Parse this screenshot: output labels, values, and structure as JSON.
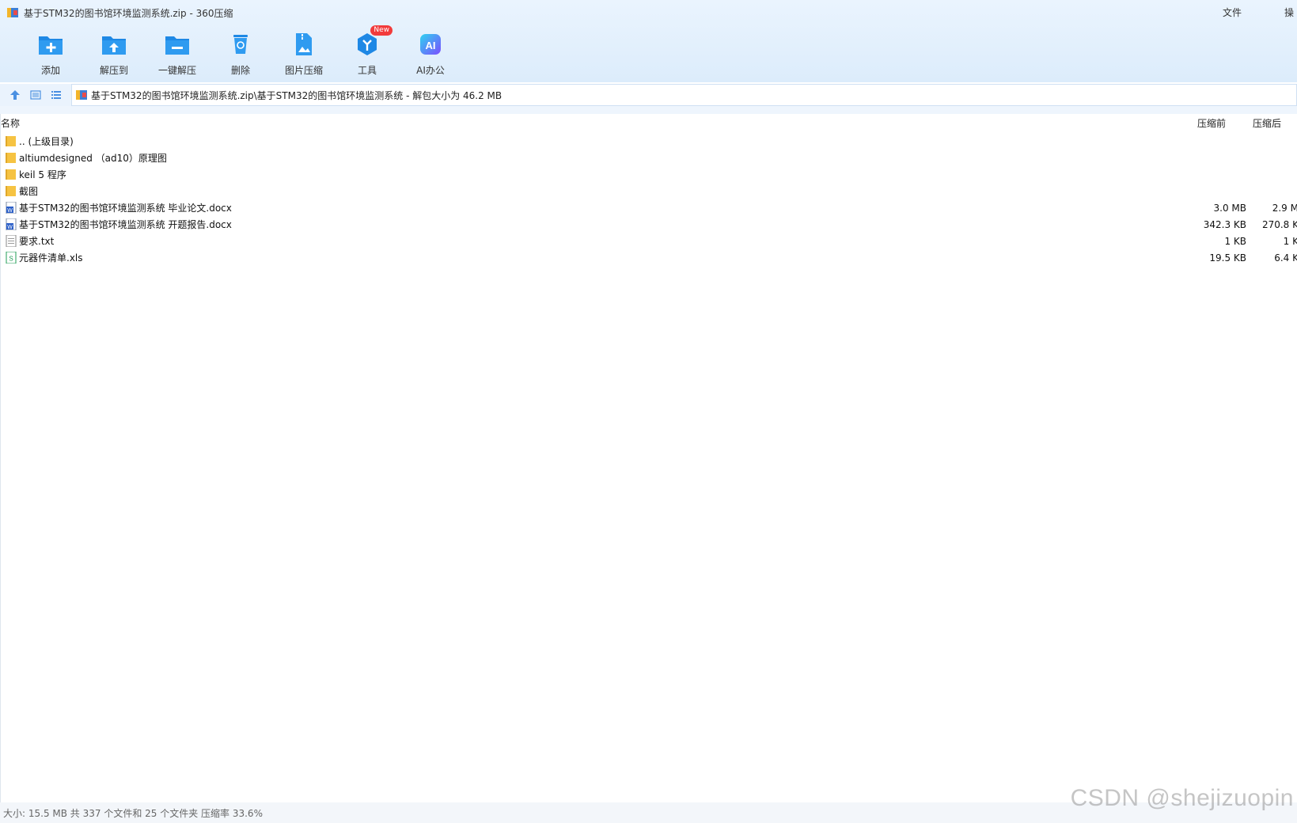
{
  "window": {
    "title": "基于STM32的图书馆环境监测系统.zip - 360压缩",
    "menu": [
      "文件",
      "操"
    ]
  },
  "toolbar": [
    {
      "label": "添加",
      "icon": "add-icon"
    },
    {
      "label": "解压到",
      "icon": "extract-to-icon"
    },
    {
      "label": "一键解压",
      "icon": "one-click-extract-icon"
    },
    {
      "label": "删除",
      "icon": "delete-icon"
    },
    {
      "label": "图片压缩",
      "icon": "image-compress-icon"
    },
    {
      "label": "工具",
      "icon": "tools-icon",
      "badge": "New"
    },
    {
      "label": "AI办公",
      "icon": "ai-office-icon",
      "glyph": "AI"
    }
  ],
  "address": {
    "path": "基于STM32的图书馆环境监测系统.zip\\基于STM32的图书馆环境监测系统 - 解包大小为 46.2 MB"
  },
  "columns": {
    "name": "名称",
    "before": "压缩前",
    "after": "压缩后"
  },
  "files": [
    {
      "name": ".. (上级目录)",
      "type": "folder",
      "before": "",
      "after": ""
    },
    {
      "name": "altiumdesigned （ad10）原理图",
      "type": "folder",
      "before": "",
      "after": ""
    },
    {
      "name": "keil 5 程序",
      "type": "folder",
      "before": "",
      "after": ""
    },
    {
      "name": "截图",
      "type": "folder",
      "before": "",
      "after": ""
    },
    {
      "name": "基于STM32的图书馆环境监测系统 毕业论文.docx",
      "type": "word",
      "before": "3.0 MB",
      "after": "2.9 M"
    },
    {
      "name": "基于STM32的图书馆环境监测系统 开题报告.docx",
      "type": "word",
      "before": "342.3 KB",
      "after": "270.8 K"
    },
    {
      "name": "要求.txt",
      "type": "txt",
      "before": "1 KB",
      "after": "1 K"
    },
    {
      "name": "元器件清单.xls",
      "type": "xls",
      "before": "19.5 KB",
      "after": "6.4 K"
    }
  ],
  "status": "大小: 15.5 MB 共 337 个文件和 25 个文件夹 压缩率 33.6%",
  "watermark": "CSDN @shejizuopin",
  "colors": {
    "accent": "#1e88e5",
    "folder": "#f6c342",
    "word": "#2b5fc8",
    "xls": "#1f9d55",
    "badge": "#f23b3b"
  }
}
